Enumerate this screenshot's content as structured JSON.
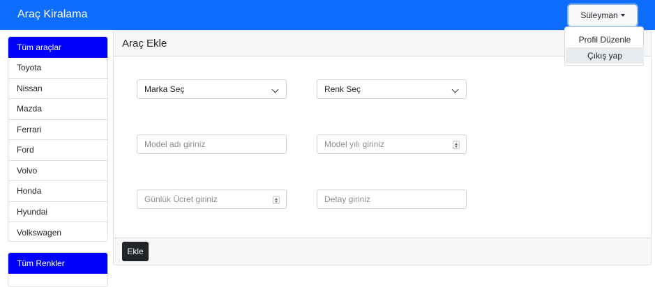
{
  "navbar": {
    "brand": "Araç Kiralama",
    "user_label": "Süleyman",
    "user_menu": [
      "Profil Düzenle",
      "Çıkış yap"
    ]
  },
  "sidebar": {
    "brands": [
      "Tüm araçlar",
      "Toyota",
      "Nissan",
      "Mazda",
      "Ferrari",
      "Ford",
      "Volvo",
      "Honda",
      "Hyundai",
      "Volkswagen"
    ],
    "colors": [
      "Tüm Renkler"
    ]
  },
  "form": {
    "title": "Araç Ekle",
    "brand_select": "Marka Seç",
    "color_select": "Renk Seç",
    "model_name_placeholder": "Model adı giriniz",
    "model_year_placeholder": "Model yılı giriniz",
    "daily_price_placeholder": "Günlük Ücret giriniz",
    "description_placeholder": "Detay giriniz",
    "submit_label": "Ekle"
  },
  "colors": {
    "navbar_bg": "#0d6efd",
    "sidebar_active": "#0000ff",
    "submit_bg": "#212529"
  },
  "icons": {
    "user_dropdown": "caret-down-icon",
    "select_chevron": "chevron-down-icon",
    "number_spinner": "spinner-icon"
  }
}
